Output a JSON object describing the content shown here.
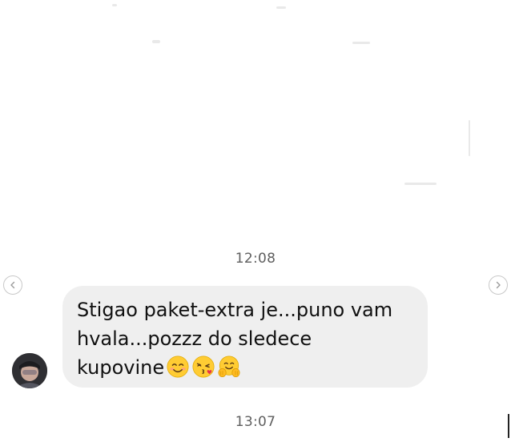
{
  "conversation": {
    "timestamps": [
      "12:08",
      "13:07"
    ],
    "message": {
      "text": "Stigao paket-extra je...puno vam hvala...pozzz do sledece kupovine",
      "line1": "Stigao paket-extra je...puno vam",
      "line2": "hvala...pozzz do sledece",
      "line3": "kupovine",
      "emojis": [
        "smiling-face-icon",
        "face-blowing-kiss-icon",
        "hugging-face-icon"
      ]
    }
  },
  "navigation": {
    "prev_icon": "chevron-left-icon",
    "next_icon": "chevron-right-icon"
  },
  "colors": {
    "bubble": "#efefef",
    "timestamp": "#5f5f5f",
    "text": "#111111",
    "background": "#ffffff"
  }
}
